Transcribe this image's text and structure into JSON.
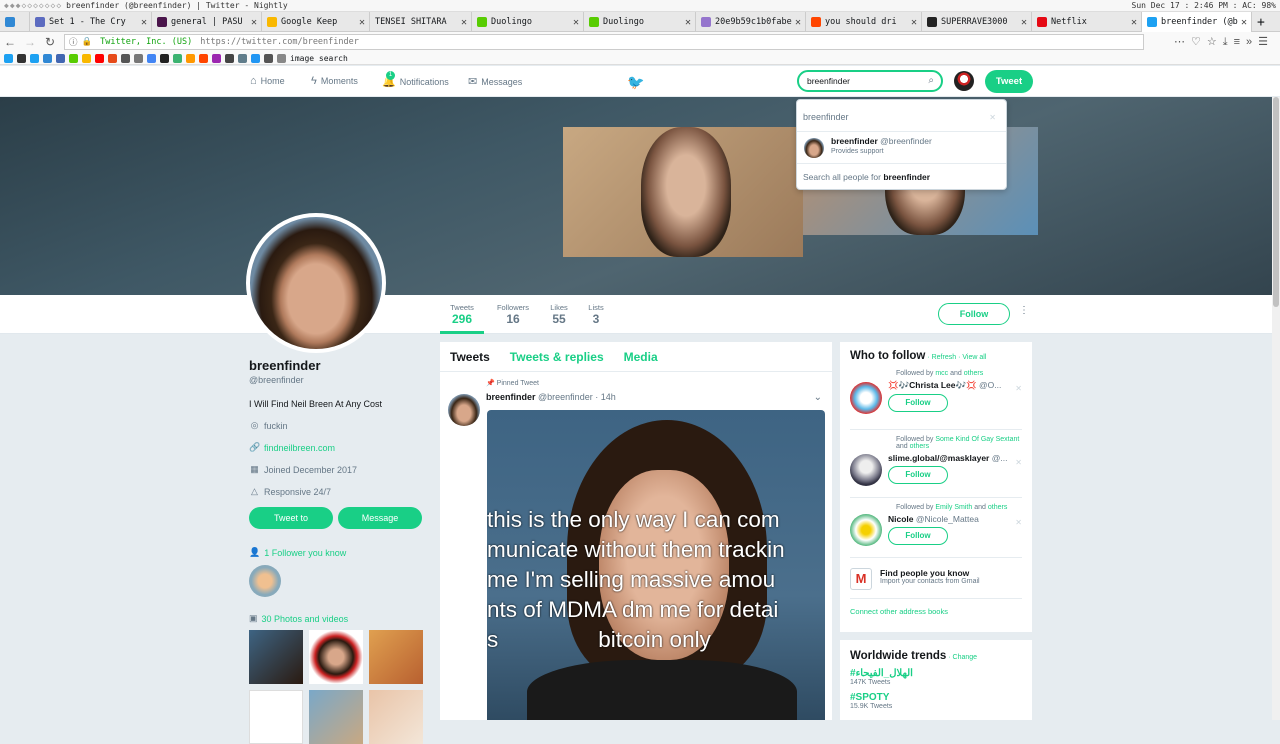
{
  "system": {
    "window_title": "breenfinder (@breenfinder) | Twitter - Nightly",
    "clock": "Sun Dec 17 : 2:46 PM : AC: 98%"
  },
  "browser": {
    "tabs": [
      {
        "label": "Set 1 - The Cry",
        "color": "#5c6bc0"
      },
      {
        "label": "general | PASU",
        "color": "#4a154b"
      },
      {
        "label": "Google Keep",
        "color": "#f9b800"
      },
      {
        "label": "TENSEI SHITARA",
        "color": "#888888"
      },
      {
        "label": "Duolingo",
        "color": "#58cc02"
      },
      {
        "label": "Duolingo",
        "color": "#58cc02"
      },
      {
        "label": "20e9b59c1b0fabe",
        "color": "#9575cd"
      },
      {
        "label": "you should dri",
        "color": "#ff4500"
      },
      {
        "label": "SUPERRAVE3000",
        "color": "#222222"
      },
      {
        "label": "Netflix",
        "color": "#e50914"
      },
      {
        "label": "breenfinder (@b",
        "color": "#1da1f2"
      }
    ],
    "url_secure": "Twitter, Inc. (US)",
    "url": "https://twitter.com/breenfinder",
    "bookmark_label": "image search"
  },
  "nav": {
    "home": "Home",
    "moments": "Moments",
    "notifications": "Notifications",
    "notification_count": "1",
    "messages": "Messages",
    "search_value": "breenfinder",
    "tweet_button": "Tweet"
  },
  "search_dropdown": {
    "query": "breenfinder",
    "user_name": "breenfinder",
    "user_handle": "@breenfinder",
    "user_bio": "Provides support",
    "search_all_prefix": "Search all people for ",
    "search_all_term": "breenfinder"
  },
  "stats": {
    "tweets_label": "Tweets",
    "tweets": "296",
    "followers_label": "Followers",
    "followers": "16",
    "likes_label": "Likes",
    "likes": "55",
    "lists_label": "Lists",
    "lists": "3",
    "follow_button": "Follow"
  },
  "profile": {
    "name": "breenfinder",
    "handle": "@breenfinder",
    "bio": "I Will Find Neil Breen At Any Cost",
    "location": "fuckin",
    "website": "findneilbreen.com",
    "joined": "Joined December 2017",
    "extra": "Responsive 24/7",
    "tweet_to": "Tweet to",
    "message": "Message",
    "followers_you_know": "1 Follower you know",
    "photos_videos": "30 Photos and videos"
  },
  "timeline": {
    "tabs": [
      "Tweets",
      "Tweets & replies",
      "Media"
    ],
    "pinned_label": "Pinned Tweet",
    "tweet_name": "breenfinder",
    "tweet_meta": "@breenfinder · 14h",
    "image_text": "this is the only way I can com\nmunicate without them trackin\nme I'm selling massive amou\nnts of MDMA dm me for detai\ns                bitcoin only"
  },
  "who_to_follow": {
    "title": "Who to follow",
    "refresh": "Refresh",
    "view_all": "View all",
    "accounts": [
      {
        "followed_by": "Followed by",
        "followed_names": "mcc",
        "and": "and",
        "others": "others",
        "name": "💢🎶Christa Lee🎶💢",
        "handle": "@O...",
        "follow": "Follow"
      },
      {
        "followed_by": "Followed by",
        "followed_names": "Some Kind Of Gay Sextant",
        "and": "and",
        "others": "others",
        "name": "slime.global/@masklayer",
        "handle": "@...",
        "follow": "Follow"
      },
      {
        "followed_by": "Followed by",
        "followed_names": "Emily Smith",
        "and": "and",
        "others": "others",
        "name": "Nicole",
        "handle": "@Nicole_Mattea",
        "follow": "Follow"
      }
    ],
    "find_people_title": "Find people you know",
    "find_people_sub": "Import your contacts from Gmail",
    "connect_other": "Connect other address books"
  },
  "trends": {
    "title": "Worldwide trends",
    "change": "Change",
    "items": [
      {
        "tag": "#الهلال_الفيحاء",
        "count": "147K Tweets"
      },
      {
        "tag": "#SPOTY",
        "count": "15.9K Tweets"
      }
    ]
  }
}
